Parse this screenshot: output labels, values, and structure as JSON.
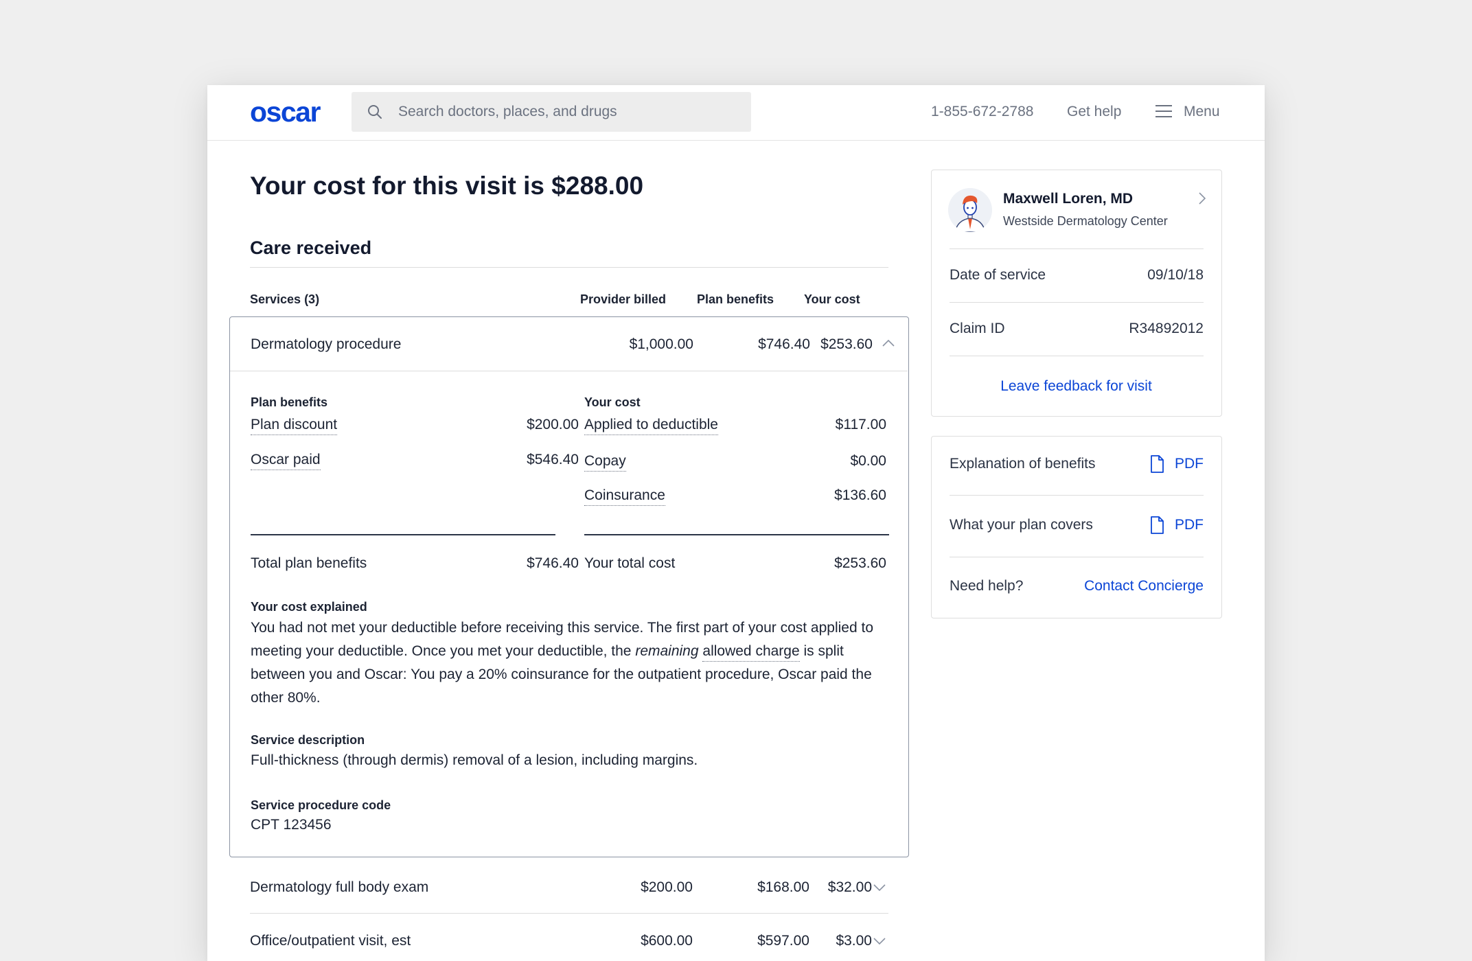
{
  "header": {
    "logo": "oscar",
    "search_placeholder": "Search doctors, places, and drugs",
    "phone": "1-855-672-2788",
    "get_help": "Get help",
    "menu": "Menu"
  },
  "main": {
    "title": "Your cost for this visit is $288.00",
    "care_received": "Care received",
    "columns": {
      "services": "Services (3)",
      "provider_billed": "Provider billed",
      "plan_benefits": "Plan benefits",
      "your_cost": "Your cost"
    },
    "services": [
      {
        "name": "Dermatology procedure",
        "billed": "$1,000.00",
        "benefits": "$746.40",
        "cost": "$253.60",
        "expanded": true
      },
      {
        "name": "Dermatology full body exam",
        "billed": "$200.00",
        "benefits": "$168.00",
        "cost": "$32.00",
        "expanded": false
      },
      {
        "name": "Office/outpatient visit, est",
        "billed": "$600.00",
        "benefits": "$597.00",
        "cost": "$3.00",
        "expanded": false
      }
    ],
    "detail": {
      "plan_benefits_head": "Plan benefits",
      "your_cost_head": "Your cost",
      "plan_items": [
        {
          "label": "Plan discount",
          "value": "$200.00"
        },
        {
          "label": "Oscar paid",
          "value": "$546.40"
        }
      ],
      "cost_items": [
        {
          "label": "Applied to deductible",
          "value": "$117.00"
        },
        {
          "label": "Copay",
          "value": "$0.00"
        },
        {
          "label": "Coinsurance",
          "value": "$136.60"
        }
      ],
      "total_plan_label": "Total plan benefits",
      "total_plan_value": "$746.40",
      "total_cost_label": "Your total cost",
      "total_cost_value": "$253.60",
      "explained_head": "Your cost explained",
      "explained_1": "You had not met your deductible before receiving this service. The first part of your cost applied to meeting your deductible. Once you met your deductible, the ",
      "explained_em": "remaining",
      "explained_space": " ",
      "explained_link": "allowed charge",
      "explained_2": " is split between you and Oscar: You pay a 20% coinsurance for the outpatient procedure, Oscar paid the other 80%.",
      "desc_head": "Service description",
      "desc_text": "Full-thickness (through dermis) removal of a lesion, including margins.",
      "code_head": "Service procedure code",
      "code_text": "CPT 123456"
    }
  },
  "sidebar": {
    "doctor_name": "Maxwell Loren, MD",
    "doctor_org": "Westside Dermatology Center",
    "date_label": "Date of service",
    "date_value": "09/10/18",
    "claim_label": "Claim ID",
    "claim_value": "R34892012",
    "feedback": "Leave feedback for visit",
    "eob_label": "Explanation of benefits",
    "eob_link": "PDF",
    "covers_label": "What your plan covers",
    "covers_link": "PDF",
    "help_label": "Need help?",
    "help_link": "Contact Concierge"
  },
  "colors": {
    "brand": "#0b45d6",
    "text": "#1c2333",
    "muted": "#6b7280",
    "background": "#efefef"
  },
  "icons": [
    "search-icon",
    "menu-icon",
    "chevron-up-icon",
    "chevron-down-icon",
    "chevron-right-icon",
    "document-icon",
    "doctor-avatar"
  ]
}
